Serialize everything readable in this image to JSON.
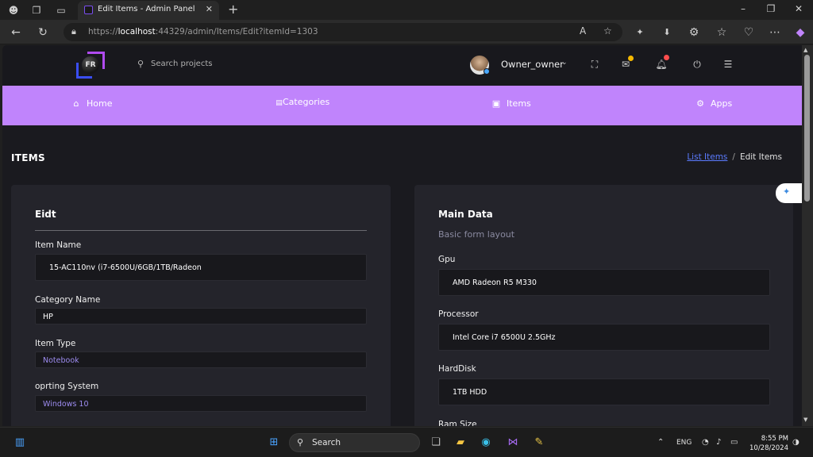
{
  "browser": {
    "tab_title": "Edit Items - Admin Panel",
    "url_prefix": "https://",
    "url_host": "localhost",
    "url_rest": ":44329/admin/Items/Edit?itemId=1303"
  },
  "header": {
    "search_placeholder": "Search projects",
    "user_name": "Owner_owner",
    "logo_text": "FR"
  },
  "nav": {
    "items": [
      {
        "label": "Home",
        "icon": "home-icon"
      },
      {
        "label": "Categories",
        "icon": "categories-icon"
      },
      {
        "label": "Items",
        "icon": "bag-icon"
      },
      {
        "label": "Apps",
        "icon": "gear-icon"
      }
    ]
  },
  "page": {
    "title": "ITEMS",
    "breadcrumb_link": "List Items",
    "breadcrumb_sep": "/",
    "breadcrumb_current": "Edit Items"
  },
  "left_card": {
    "title": "Eidt",
    "fields": [
      {
        "label": "Item Name",
        "value": "15-AC110nv (i7-6500U/6GB/1TB/Radeon"
      },
      {
        "label": "Category Name",
        "value": "HP"
      },
      {
        "label": "Item Type",
        "value": "Notebook"
      },
      {
        "label": "oprting System",
        "value": "Windows 10"
      }
    ]
  },
  "right_card": {
    "title": "Main Data",
    "subtitle": "Basic form layout",
    "fields": [
      {
        "label": "Gpu",
        "value": "AMD Radeon R5 M330"
      },
      {
        "label": "Processor",
        "value": "Intel Core i7 6500U 2.5GHz"
      },
      {
        "label": "HardDisk",
        "value": "1TB HDD"
      },
      {
        "label": "Ram Size",
        "value": ""
      }
    ]
  },
  "taskbar": {
    "search_label": "Search",
    "language": "ENG",
    "time": "8:55 PM",
    "date": "10/28/2024"
  },
  "colors": {
    "accent_nav": "#c084fc",
    "page_bg": "#1a1a1f",
    "card_bg": "#24242b",
    "link": "#5b7bff"
  }
}
